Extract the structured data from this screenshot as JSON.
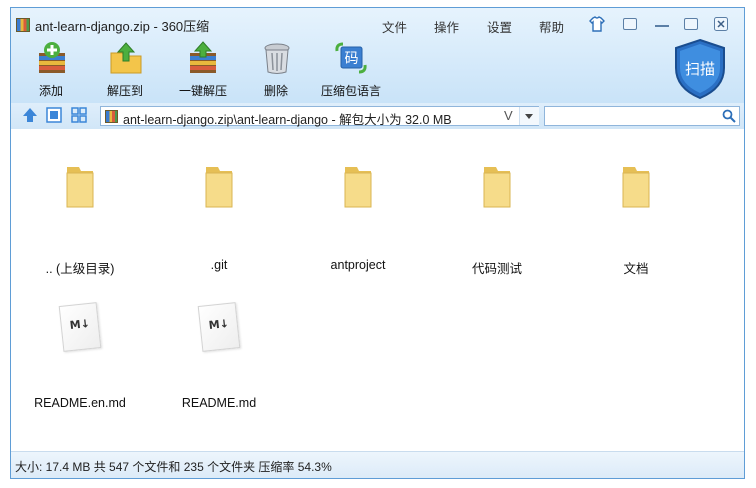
{
  "window": {
    "title": "ant-learn-django.zip - 360压缩",
    "menu": [
      "文件",
      "操作",
      "设置",
      "帮助"
    ]
  },
  "toolbar": {
    "buttons": [
      {
        "label": "添加",
        "icon": "add-archive-icon"
      },
      {
        "label": "解压到",
        "icon": "extract-to-icon"
      },
      {
        "label": "一键解压",
        "icon": "one-click-extract-icon"
      },
      {
        "label": "删除",
        "icon": "delete-trash-icon"
      },
      {
        "label": "压缩包语言",
        "icon": "archive-language-icon"
      }
    ],
    "language_badge": "码",
    "scan_label": "扫描"
  },
  "address": {
    "path": "ant-learn-django.zip\\ant-learn-django - 解包大小为 32.0 MB",
    "v_label": "V",
    "search_placeholder": ""
  },
  "files": [
    {
      "name": ".. (上级目录)",
      "type": "folder"
    },
    {
      "name": ".git",
      "type": "folder"
    },
    {
      "name": "antproject",
      "type": "folder"
    },
    {
      "name": "代码测试",
      "type": "folder"
    },
    {
      "name": "文档",
      "type": "folder"
    },
    {
      "name": "README.en.md",
      "type": "markdown"
    },
    {
      "name": "README.md",
      "type": "markdown"
    }
  ],
  "file_icon_text": {
    "markdown": "M↓"
  },
  "status": {
    "text": "大小: 17.4 MB 共 547 个文件和 235 个文件夹 压缩率 54.3%"
  },
  "colors": {
    "accent": "#3b7fd1",
    "folder": "#f3d57a",
    "window_border": "#5f9dd6"
  }
}
